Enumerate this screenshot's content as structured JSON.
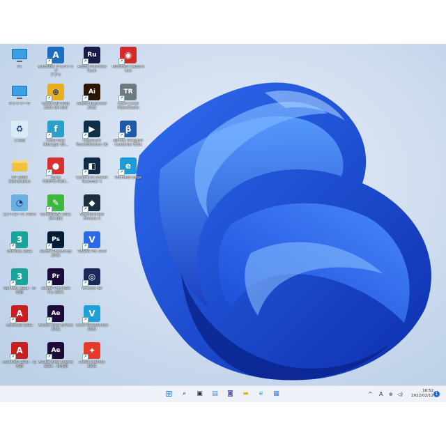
{
  "desktop": {
    "icons": [
      {
        "label": "PC",
        "icon": "monitor-icon",
        "badge": "",
        "color": "#3aa0e6",
        "col": 0,
        "row": 0
      },
      {
        "label": "Autodesk デスクトップ\nアプリ",
        "icon": "autodesk-app-icon",
        "badge": "A",
        "color": "#1c6fbf",
        "col": 1,
        "row": 0
      },
      {
        "label": "Adobe Premiere\nRush",
        "icon": "premiere-rush-icon",
        "badge": "Ru",
        "color": "#1b1a4a",
        "col": 2,
        "row": 0
      },
      {
        "label": "Multicam Capture\nLite",
        "icon": "multicam-capture-icon",
        "badge": "◉",
        "color": "#d42a2a",
        "col": 3,
        "row": 0
      },
      {
        "label": "ネットワーク",
        "icon": "network-icon",
        "badge": "",
        "color": "#3aa0e6",
        "col": 0,
        "row": 1
      },
      {
        "label": "Corel CAPTURE\n2021 (64-bit)",
        "icon": "corel-capture-icon",
        "badge": "⊕",
        "color": "#e8b020",
        "col": 1,
        "row": 1
      },
      {
        "label": "Adobe Illustrator\n2022",
        "icon": "illustrator-icon",
        "badge": "Ai",
        "color": "#2d1605",
        "col": 2,
        "row": 1
      },
      {
        "label": "Learn Corel\nVideoStudio",
        "icon": "learn-videostudio-icon",
        "badge": "TR",
        "color": "#6d7a80",
        "col": 3,
        "row": 1
      },
      {
        "label": "ごみ箱",
        "icon": "recycle-bin-icon",
        "badge": "♻",
        "color": "#d8ecf8",
        "col": 0,
        "row": 2
      },
      {
        "label": "Corel Font\nManager 20...",
        "icon": "corel-font-manager-icon",
        "badge": "f",
        "color": "#2aa0c8",
        "col": 1,
        "row": 2
      },
      {
        "label": "CyberLink\nPowerDirector 20",
        "icon": "powerdirector-icon",
        "badge": "▶",
        "color": "#10304a",
        "col": 2,
        "row": 2
      },
      {
        "label": "Affinity Designer\nCustomer Beta",
        "icon": "affinity-designer-icon",
        "badge": "β",
        "color": "#1e5aa8",
        "col": 3,
        "row": 2
      },
      {
        "label": "HP Z640\nWorkstation",
        "icon": "folder-icon",
        "badge": "",
        "color": "#f0c040",
        "col": 0,
        "row": 3
      },
      {
        "label": "Corel\nPHOTO-PAIN...",
        "icon": "corel-photo-paint-icon",
        "badge": "●",
        "color": "#d83030",
        "col": 1,
        "row": 3
      },
      {
        "label": "CyberLink Screen\nRecorder 4",
        "icon": "screen-recorder-icon",
        "badge": "◧",
        "color": "#0e2a44",
        "col": 2,
        "row": 3
      },
      {
        "label": "Microsoft Edge",
        "icon": "edge-icon",
        "badge": "e",
        "color": "#1d9bd8",
        "col": 3,
        "row": 3
      },
      {
        "label": "コントロール パネル",
        "icon": "control-panel-icon",
        "badge": "◔",
        "color": "#6ab0e0",
        "col": 0,
        "row": 4
      },
      {
        "label": "CorelDRAW 2021\n(64-Bit)",
        "icon": "coreldraw-icon",
        "badge": "✎",
        "color": "#3cb83c",
        "col": 1,
        "row": 4
      },
      {
        "label": "Wondershare\nFilmora X",
        "icon": "filmora-icon",
        "badge": "◆",
        "color": "#1e3040",
        "col": 2,
        "row": 4
      },
      {
        "label": "3ds Max 2021",
        "icon": "3dsmax-icon",
        "badge": "3",
        "color": "#1aa39a",
        "col": 0,
        "row": 5
      },
      {
        "label": "Adobe Photoshop\n2021",
        "icon": "photoshop-icon",
        "badge": "Ps",
        "color": "#001c36",
        "col": 1,
        "row": 5
      },
      {
        "label": "VEGAS Pro 19.0",
        "icon": "vegas-pro-icon",
        "badge": "V",
        "color": "#2a6ae8",
        "col": 2,
        "row": 5
      },
      {
        "label": "3ds Max 2021 - 日\n本語",
        "icon": "3dsmax-jp-icon",
        "badge": "3",
        "color": "#1aa39a",
        "col": 0,
        "row": 6
      },
      {
        "label": "Adobe Premiere\nPro 2021",
        "icon": "premiere-pro-icon",
        "badge": "Pr",
        "color": "#1a0b38",
        "col": 1,
        "row": 6
      },
      {
        "label": "Cinema 4D",
        "icon": "cinema4d-icon",
        "badge": "◎",
        "color": "#1a2a5a",
        "col": 2,
        "row": 6
      },
      {
        "label": "AutoCAD 2021",
        "icon": "autocad-icon",
        "badge": "A",
        "color": "#c81e1e",
        "col": 0,
        "row": 7
      },
      {
        "label": "Adobe After Effects\n2021",
        "icon": "after-effects-icon",
        "badge": "Ae",
        "color": "#1a0b38",
        "col": 1,
        "row": 7
      },
      {
        "label": "Corel VideoStudio\n2021",
        "icon": "videostudio-icon",
        "badge": "V",
        "color": "#20a0d8",
        "col": 2,
        "row": 7
      },
      {
        "label": "AutoCAD 2021 - 日\n本語",
        "icon": "autocad-jp-icon",
        "badge": "A",
        "color": "#c81e1e",
        "col": 0,
        "row": 8
      },
      {
        "label": "Adobe After Effects\n2021 - 日本語",
        "icon": "after-effects-jp-icon",
        "badge": "Ae",
        "color": "#1a0b38",
        "col": 1,
        "row": 8
      },
      {
        "label": "Corel FastFlick 2021",
        "icon": "fastflick-icon",
        "badge": "✦",
        "color": "#e83a2a",
        "col": 2,
        "row": 8
      }
    ]
  },
  "taskbar": {
    "items": [
      {
        "icon": "start-icon",
        "glyph": "⊞",
        "color": "#1a78d8"
      },
      {
        "icon": "search-icon",
        "glyph": "⌕",
        "color": "#222222"
      },
      {
        "icon": "task-view-icon",
        "glyph": "▣",
        "color": "#333333"
      },
      {
        "icon": "widgets-icon",
        "glyph": "▤",
        "color": "#2a8ad8"
      },
      {
        "icon": "teams-chat-icon",
        "glyph": "◙",
        "color": "#6264a7"
      },
      {
        "icon": "file-explorer-icon",
        "glyph": "▬",
        "color": "#e8b820"
      },
      {
        "icon": "edge-icon",
        "glyph": "e",
        "color": "#1d9bd8"
      },
      {
        "icon": "store-icon",
        "glyph": "▦",
        "color": "#2a7ad8"
      }
    ],
    "tray": {
      "chevron": "^",
      "ime": "A",
      "time": "16:52",
      "date": "2022/02/12",
      "notification_count": "1"
    }
  }
}
